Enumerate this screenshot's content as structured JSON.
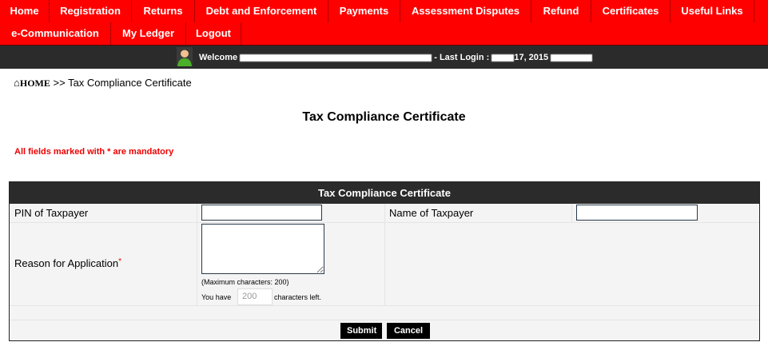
{
  "nav": {
    "row1": [
      "Home",
      "Registration",
      "Returns",
      "Debt and Enforcement",
      "Payments",
      "Assessment Disputes",
      "Refund",
      "Certificates",
      "Useful Links"
    ],
    "row2": [
      "e-Communication",
      "My Ledger",
      "Logout"
    ]
  },
  "welcome": {
    "prefix": "Welcome",
    "last_login_label": "- Last Login :",
    "last_login_partial": "17, 2015"
  },
  "breadcrumb": {
    "home": "HOME",
    "sep": ">>",
    "current": "Tax Compliance Certificate"
  },
  "page_title": "Tax Compliance Certificate",
  "mandatory_note": "All fields marked with * are mandatory",
  "form": {
    "header": "Tax Compliance Certificate",
    "pin_label": "PIN of Taxpayer",
    "name_label": "Name of Taxpayer",
    "reason_label": "Reason for Application",
    "required_mark": "*",
    "max_chars": "(Maximum characters: 200)",
    "you_have": "You have",
    "remaining": "200",
    "chars_left": "characters left.",
    "submit": "Submit",
    "cancel": "Cancel"
  },
  "colors": {
    "nav": "#ff0000",
    "bar": "#2b2b2b",
    "required": "#e00000"
  }
}
